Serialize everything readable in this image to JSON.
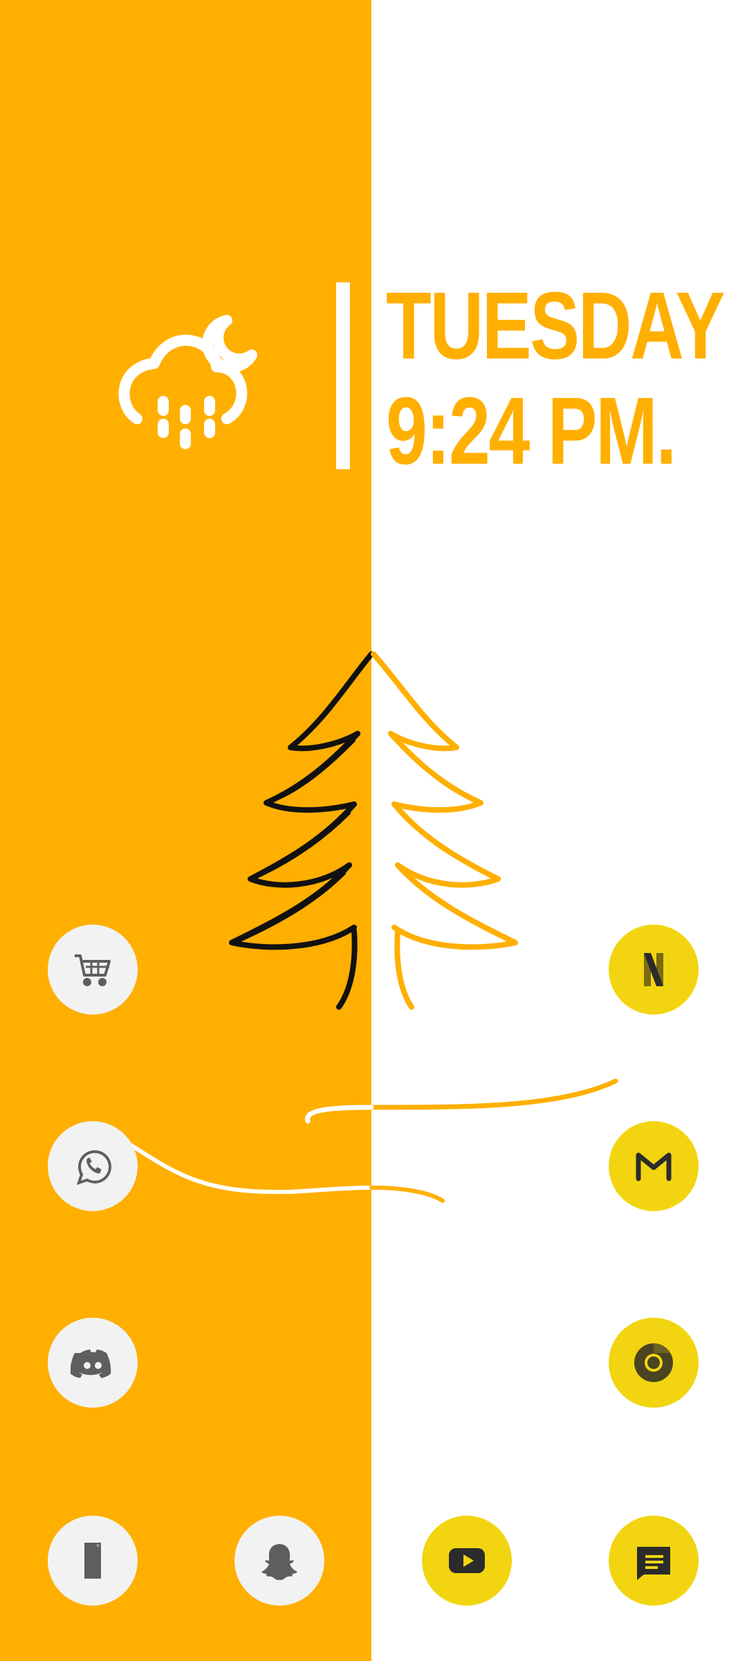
{
  "clock": {
    "day": "TUESDAY",
    "time": "9:24 PM."
  },
  "weather": {
    "icon": "cloud-moon-rain-icon"
  },
  "colors": {
    "accent": "#FFAF00",
    "icon_yellow": "#F2D510",
    "icon_light": "#F2F2F2",
    "icon_glyph": "#5E5E5E"
  },
  "apps": [
    {
      "name": "shopping-cart",
      "icon": "shopping-cart-icon"
    },
    {
      "name": "whatsapp",
      "icon": "whatsapp-icon"
    },
    {
      "name": "discord",
      "icon": "discord-icon"
    },
    {
      "name": "phone",
      "icon": "phone-icon"
    },
    {
      "name": "snapchat",
      "icon": "snapchat-icon"
    },
    {
      "name": "netflix",
      "icon": "netflix-icon"
    },
    {
      "name": "gmail",
      "icon": "gmail-icon"
    },
    {
      "name": "chrome",
      "icon": "chrome-icon"
    },
    {
      "name": "youtube",
      "icon": "youtube-icon"
    },
    {
      "name": "messages",
      "icon": "messages-icon"
    }
  ]
}
